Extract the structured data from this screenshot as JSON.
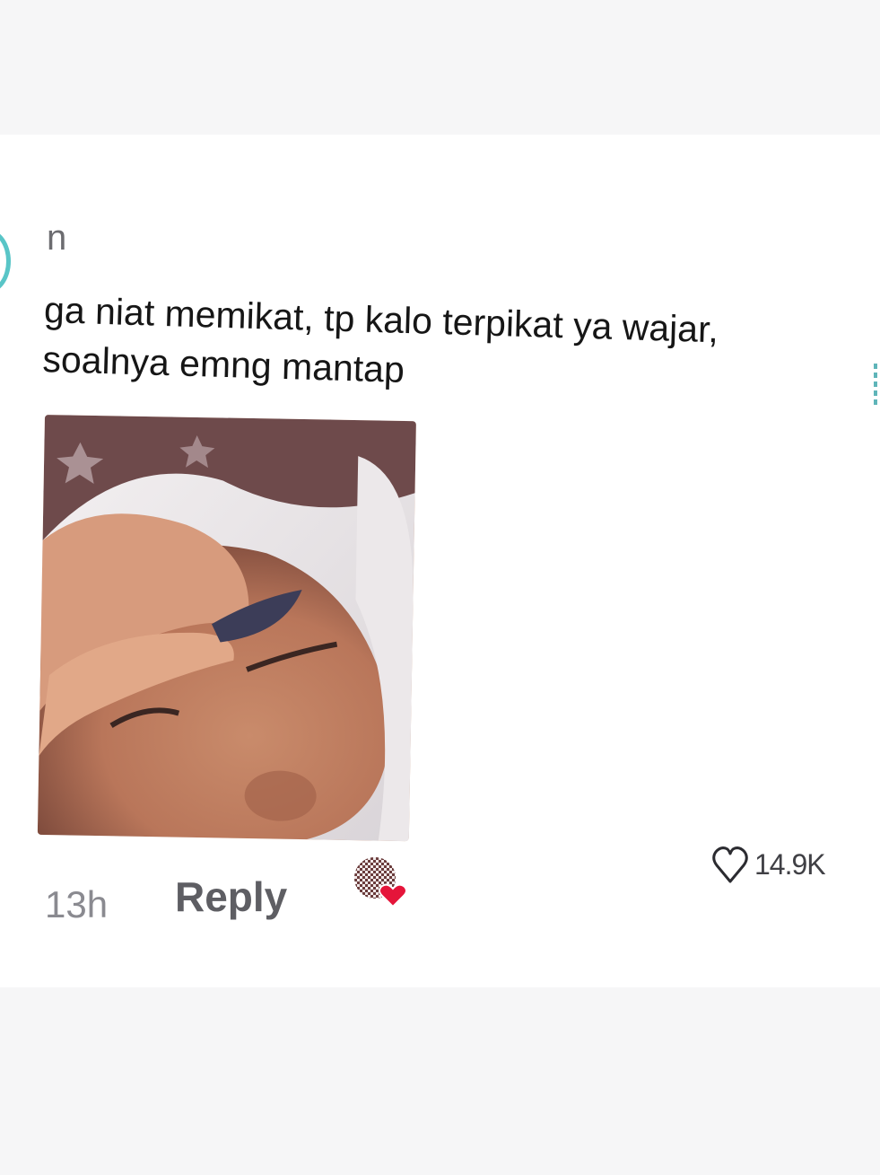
{
  "comment": {
    "username": "n",
    "text": "ga niat memikat, tp kalo terpikat ya wajar,\nsoalnya emng mantap",
    "time": "13h",
    "reply_label": "Reply",
    "like_count": "14.9K",
    "creator_liked": true
  },
  "icons": {
    "like": "heart-outline-icon",
    "creator_like": "creator-liked-avatar-heart-icon"
  },
  "colors": {
    "avatar_ring": "#59c5c7",
    "creator_heart": "#e5153a",
    "text": "#161616",
    "muted": "#8a8a90"
  }
}
